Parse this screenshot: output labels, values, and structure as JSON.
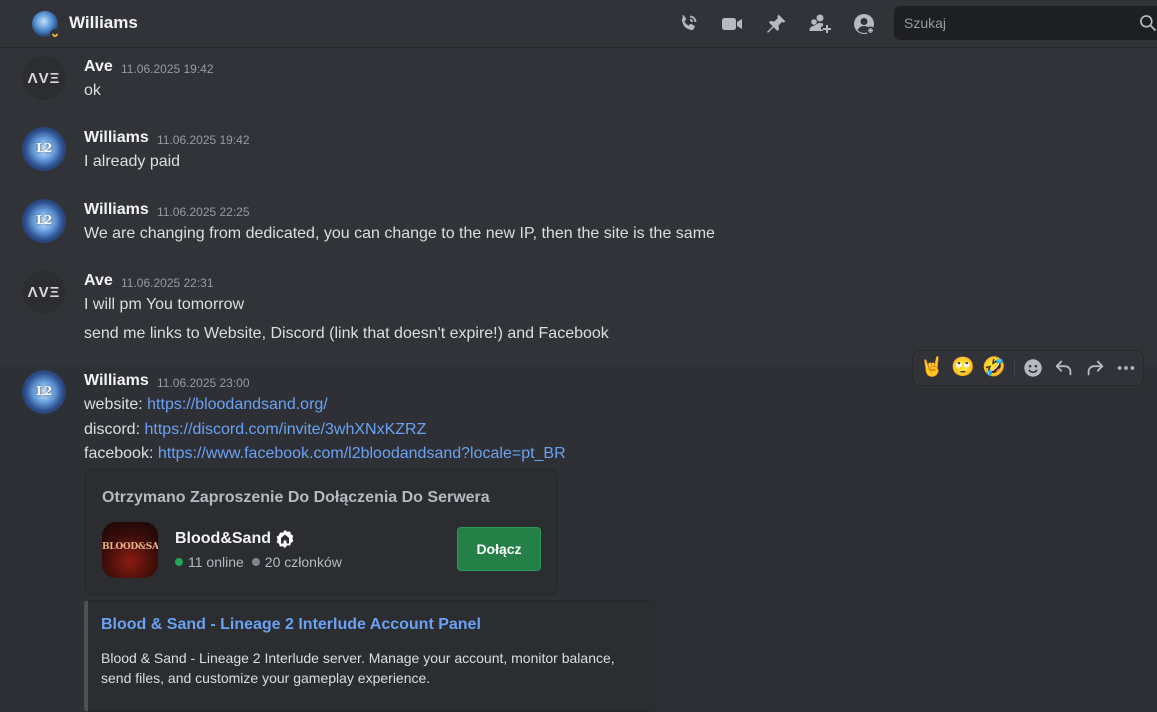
{
  "header": {
    "title": "Williams",
    "search_placeholder": "Szukaj",
    "icons": [
      "phone-call-icon",
      "video-icon",
      "pin-icon",
      "add-member-icon",
      "profile-icon",
      "search-icon"
    ]
  },
  "messages": [
    {
      "author": "Ave",
      "timestamp": "11.06.2025 19:42",
      "lines": [
        "ok"
      ],
      "avatar": "Ave"
    },
    {
      "author": "Williams",
      "timestamp": "11.06.2025 19:42",
      "lines": [
        "I already paid"
      ],
      "avatar": "L2"
    },
    {
      "author": "Williams",
      "timestamp": "11.06.2025 22:25",
      "lines": [
        "We are changing from dedicated, you can change to the new IP, then the site is the same"
      ],
      "avatar": "L2"
    },
    {
      "author": "Ave",
      "timestamp": "11.06.2025 22:31",
      "lines": [
        "I will pm You tomorrow",
        "send me links to Website, Discord (link that doesn't expire!) and Facebook"
      ],
      "avatar": "Ave"
    },
    {
      "author": "Williams",
      "timestamp": "11.06.2025 23:00",
      "avatar": "L2",
      "link_lines": [
        {
          "label": "website:",
          "url": "https://bloodandsand.org/"
        },
        {
          "label": "discord:",
          "url": "https://discord.com/invite/3whXNxKZRZ"
        },
        {
          "label": "facebook:",
          "url": "https://www.facebook.com/l2bloodandsand?locale=pt_BR"
        }
      ]
    }
  ],
  "toolbar": {
    "reactions": [
      "🤘",
      "🙄",
      "🤣"
    ],
    "icons": [
      "add-reaction-icon",
      "reply-icon",
      "forward-icon",
      "more-icon"
    ]
  },
  "invite": {
    "title": "Otrzymano Zaproszenie Do Dołączenia Do Serwera",
    "server_icon_text": "BLOOD&SAND",
    "server_name": "Blood&Sand",
    "online": "11 online",
    "members": "20 członków",
    "join_label": "Dołącz"
  },
  "embed": {
    "title": "Blood & Sand - Lineage 2 Interlude Account Panel",
    "description": "Blood & Sand - Lineage 2 Interlude server. Manage your account, monitor balance, send files, and customize your gameplay experience."
  },
  "colors": {
    "background": "#313338",
    "link": "#6aa2f3",
    "join_button": "#248046",
    "online": "#23a55a"
  }
}
